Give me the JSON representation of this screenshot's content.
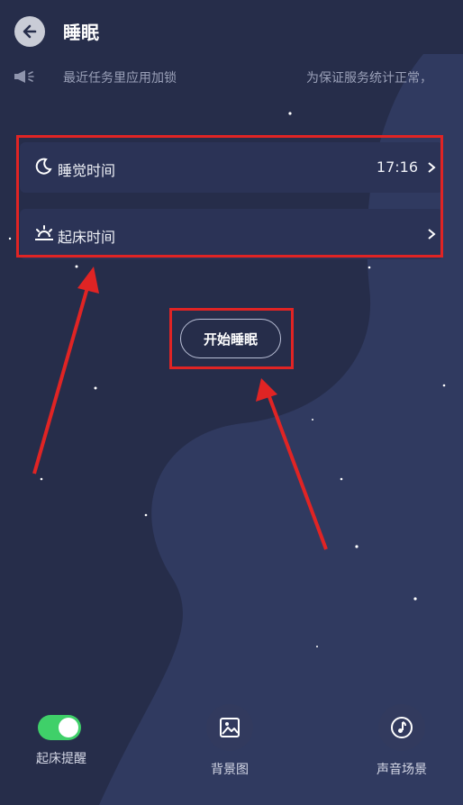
{
  "header": {
    "title": "睡眠",
    "back_icon": "arrow-left-icon"
  },
  "notice": {
    "icon": "megaphone-icon",
    "text_left": "最近任务里应用加锁",
    "text_right": "为保证服务统计正常，"
  },
  "settings": {
    "sleep_time": {
      "label": "睡觉时间",
      "value": "17:16",
      "icon": "moon-icon"
    },
    "wake_time": {
      "label": "起床时间",
      "icon": "sunrise-icon"
    }
  },
  "start_button": {
    "label": "开始睡眠"
  },
  "bottom": {
    "alarm_toggle": {
      "label": "起床提醒",
      "on": true
    },
    "background": {
      "label": "背景图",
      "icon": "image-icon"
    },
    "sound": {
      "label": "声音场景",
      "icon": "music-note-icon"
    }
  },
  "colors": {
    "background": "#262d4a",
    "wave": "#303a60",
    "card": "#2b3356",
    "toggle_on": "#3fd069",
    "highlight": "#e02424"
  }
}
